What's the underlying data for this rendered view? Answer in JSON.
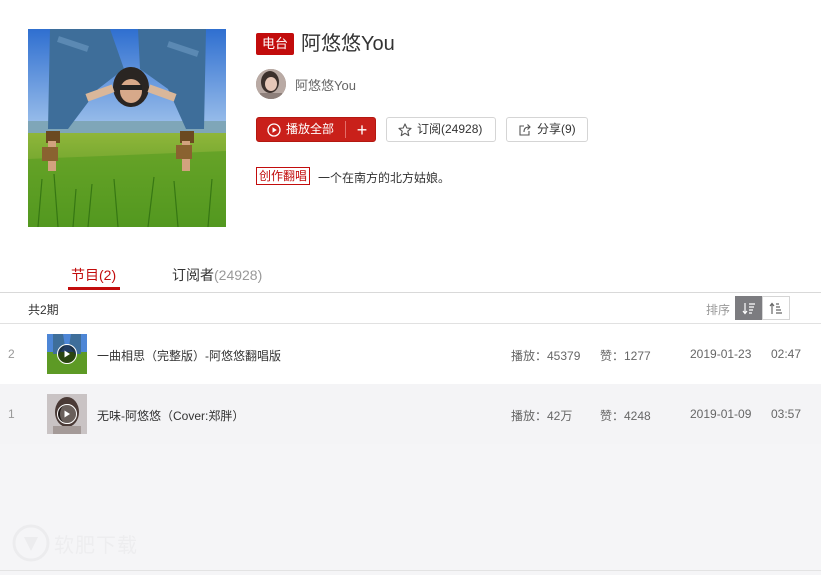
{
  "radio": {
    "badge": "电台",
    "title": "阿悠悠You",
    "author": "阿悠悠You",
    "play_all_label": "播放全部",
    "add_label": "+",
    "subscribe_label": "订阅(24928)",
    "share_label": "分享(9)",
    "category_tag": "创作翻唱",
    "description": "一个在南方的北方姑娘。"
  },
  "tabs": {
    "programs_label": "节目",
    "programs_count": "(2)",
    "subscribers_label": "订阅者",
    "subscribers_count": "(24928)"
  },
  "list_header": {
    "total": "共2期",
    "sort_label": "排序"
  },
  "programs": [
    {
      "index": "2",
      "name": "一曲相思（完整版）-阿悠悠翻唱版",
      "plays": "播放：45379",
      "likes": "赞：1277",
      "date": "2019-01-23",
      "duration": "02:47"
    },
    {
      "index": "1",
      "name": "无味-阿悠悠（Cover:郑胖）",
      "plays": "播放：42万",
      "likes": "赞：4248",
      "date": "2019-01-09",
      "duration": "03:57"
    }
  ],
  "watermark": "软肥下载",
  "colors": {
    "accent": "#c20c0c",
    "play_button": "#c9201a",
    "sort_active": "#7c7c80"
  },
  "icons": {
    "play": "play-circle-icon",
    "subscribe": "star-icon",
    "share": "share-icon",
    "sort_desc": "sort-descending-icon",
    "sort_asc": "sort-ascending-icon"
  }
}
